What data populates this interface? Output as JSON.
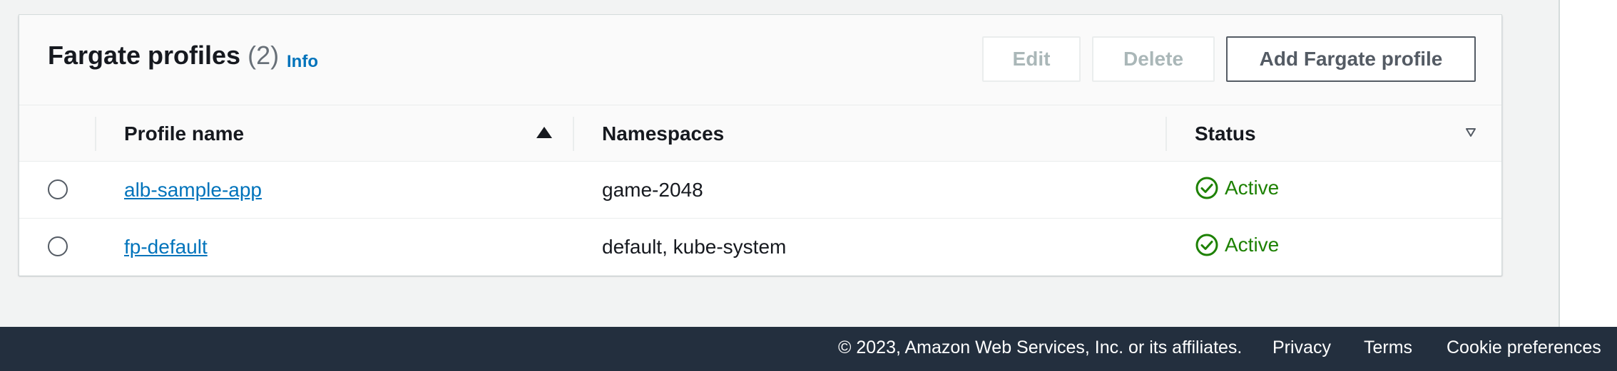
{
  "panel": {
    "title": "Fargate profiles",
    "count": "(2)",
    "info_label": "Info",
    "buttons": {
      "edit": "Edit",
      "delete": "Delete",
      "add": "Add Fargate profile"
    }
  },
  "table": {
    "columns": [
      "Profile name",
      "Namespaces",
      "Status"
    ],
    "sort": {
      "column": "Profile name",
      "direction": "ascending"
    },
    "rows": [
      {
        "name": "alb-sample-app",
        "namespaces": "game-2048",
        "status": "Active",
        "selected": false
      },
      {
        "name": "fp-default",
        "namespaces": "default, kube-system",
        "status": "Active",
        "selected": false
      }
    ]
  },
  "icons": {
    "sort": "sort-ascending-icon",
    "status": "check-circle-icon",
    "filter": "caret-down-outline-icon"
  },
  "colors": {
    "link": "#0073bb",
    "status_active": "#1d8102",
    "footer_bg": "#232f3e",
    "page_bg": "#f2f3f3"
  },
  "footer": {
    "copyright": "© 2023, Amazon Web Services, Inc. or its affiliates.",
    "privacy": "Privacy",
    "terms": "Terms",
    "cookies": "Cookie preferences"
  }
}
